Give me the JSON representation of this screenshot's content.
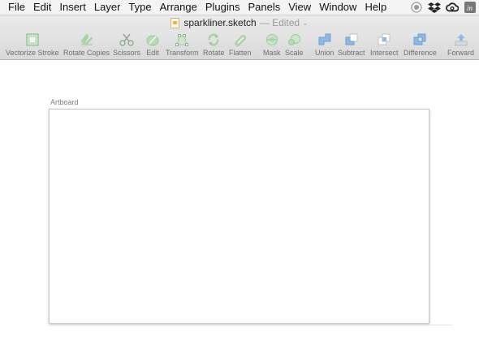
{
  "menubar": {
    "items": [
      "File",
      "Edit",
      "Insert",
      "Layer",
      "Type",
      "Arrange",
      "Plugins",
      "Panels",
      "View",
      "Window",
      "Help"
    ],
    "tray_icons": [
      "record-icon",
      "dropbox-icon",
      "creative-cloud-icon",
      "invision-icon"
    ]
  },
  "window": {
    "title": "sparkliner.sketch",
    "status": "— Edited",
    "status_chevron": "⌄"
  },
  "toolbar": {
    "buttons": [
      {
        "label": "Vectorize Stroke",
        "icon": "vectorize-stroke-icon"
      },
      {
        "label": "Rotate Copies",
        "icon": "rotate-copies-icon"
      },
      {
        "label": "Scissors",
        "icon": "scissors-icon"
      },
      {
        "label": "Edit",
        "icon": "edit-icon"
      },
      {
        "label": "Transform",
        "icon": "transform-icon"
      },
      {
        "label": "Rotate",
        "icon": "rotate-icon"
      },
      {
        "label": "Flatten",
        "icon": "flatten-icon"
      },
      {
        "label": "Mask",
        "icon": "mask-icon"
      },
      {
        "label": "Scale",
        "icon": "scale-icon"
      },
      {
        "label": "Union",
        "icon": "union-icon"
      },
      {
        "label": "Subtract",
        "icon": "subtract-icon"
      },
      {
        "label": "Intersect",
        "icon": "intersect-icon"
      },
      {
        "label": "Difference",
        "icon": "difference-icon"
      },
      {
        "label": "Forward",
        "icon": "forward-icon"
      }
    ]
  },
  "canvas": {
    "artboard_title": "Artboard"
  },
  "colors": {
    "green_icon": "#a8d3a6",
    "blue_icon": "#8fb9e3",
    "gray_icon": "#c9c9c9"
  }
}
